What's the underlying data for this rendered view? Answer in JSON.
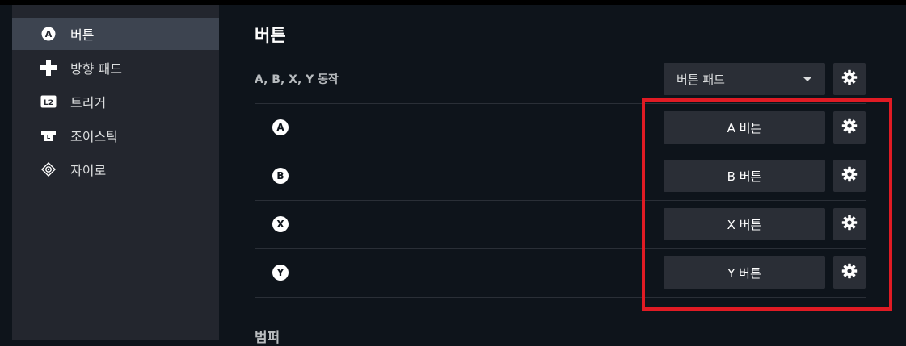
{
  "sidebar": {
    "items": [
      {
        "label": "버튼",
        "icon": "a-button-icon",
        "active": true
      },
      {
        "label": "방향 패드",
        "icon": "dpad-icon",
        "active": false
      },
      {
        "label": "트리거",
        "icon": "l2-trigger-icon",
        "active": false
      },
      {
        "label": "조이스틱",
        "icon": "joystick-icon",
        "active": false
      },
      {
        "label": "자이로",
        "icon": "gyro-icon",
        "active": false
      }
    ]
  },
  "main": {
    "title": "버튼",
    "group_label": "A, B, X, Y 동작",
    "mode_dropdown": {
      "value": "버튼 패드"
    },
    "rows": [
      {
        "glyph": "A",
        "binding": "A 버튼"
      },
      {
        "glyph": "B",
        "binding": "B 버튼"
      },
      {
        "glyph": "X",
        "binding": "X 버튼"
      },
      {
        "glyph": "Y",
        "binding": "Y 버튼"
      }
    ],
    "next_section_label": "범퍼"
  },
  "colors": {
    "background": "#0e141b",
    "sidebar": "#23262e",
    "sidebar_active": "#3d4450",
    "button": "#2a2e36",
    "highlight": "#e01b24"
  }
}
